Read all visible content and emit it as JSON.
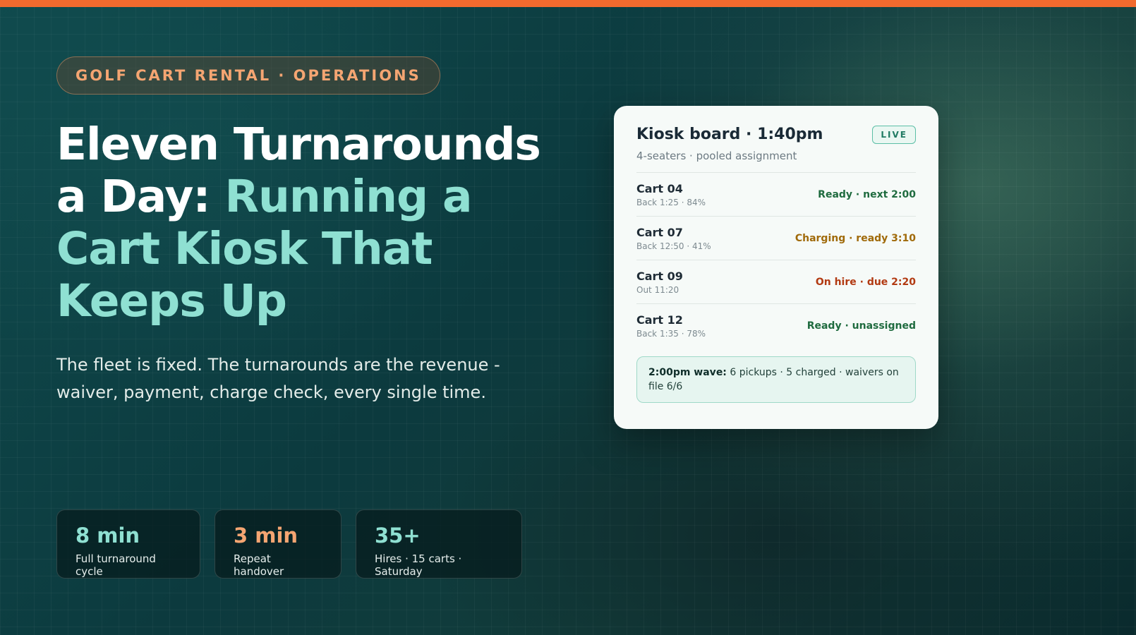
{
  "eyebrow": "GOLF CART RENTAL · OPERATIONS",
  "headline": {
    "part1": "Eleven Turnarounds a Day:",
    "part2": "Running a Cart Kiosk That Keeps Up"
  },
  "subtitle": "The fleet is fixed. The turnarounds are the revenue - waiver, payment, charge check, every single time.",
  "stats": [
    {
      "value": "8 min",
      "label": "Full turnaround cycle",
      "color": "#8fe0d2"
    },
    {
      "value": "3 min",
      "label": "Repeat handover",
      "color": "#f4a572"
    },
    {
      "value": "35+",
      "label": "Hires · 15 carts · Saturday",
      "color": "#8fe0d2"
    }
  ],
  "kiosk": {
    "title": "Kiosk board · 1:40pm",
    "subtitle": "4-seaters · pooled assignment",
    "badge": "LIVE",
    "carts": [
      {
        "name": "Cart 04",
        "meta": "Back 1:25 · 84%",
        "status": "Ready · next 2:00",
        "color": "#1f6b3f"
      },
      {
        "name": "Cart 07",
        "meta": "Back 12:50 · 41%",
        "status": "Charging · ready 3:10",
        "color": "#a06a0a"
      },
      {
        "name": "Cart 09",
        "meta": "Out 11:20",
        "status": "On hire · due 2:20",
        "color": "#b23a12"
      },
      {
        "name": "Cart 12",
        "meta": "Back 1:35 · 78%",
        "status": "Ready · unassigned",
        "color": "#1f6b3f"
      }
    ],
    "wave_label": "2:00pm wave:",
    "wave_text": " 6 pickups · 5 charged · waivers on file 6/6"
  },
  "colors": {
    "accent": "#f26a2e",
    "teal": "#8fe0d2"
  }
}
